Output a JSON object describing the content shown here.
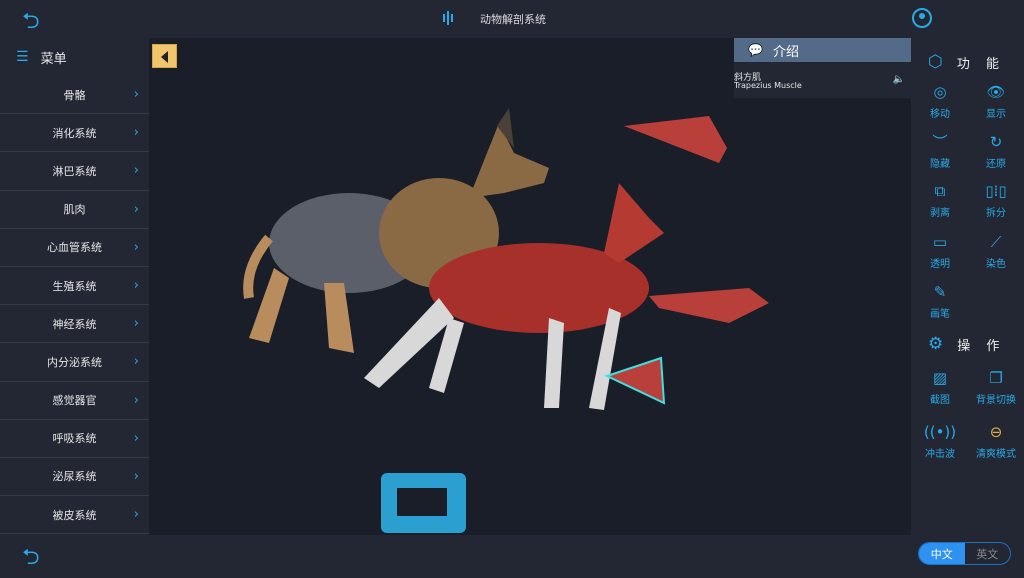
{
  "header": {
    "title": "动物解剖系统",
    "back_icon": "back-arrow-icon",
    "user_icon": "user-icon"
  },
  "sidebar": {
    "title": "菜单",
    "items": [
      {
        "label": "骨骼"
      },
      {
        "label": "消化系统"
      },
      {
        "label": "淋巴系统"
      },
      {
        "label": "肌肉"
      },
      {
        "label": "心血管系统"
      },
      {
        "label": "生殖系统"
      },
      {
        "label": "神经系统"
      },
      {
        "label": "内分泌系统"
      },
      {
        "label": "感觉器官"
      },
      {
        "label": "呼吸系统"
      },
      {
        "label": "泌尿系统"
      },
      {
        "label": "被皮系统"
      }
    ]
  },
  "intro": {
    "title": "介绍",
    "name_cn": "斜方肌",
    "name_en": "Trapezius Muscle"
  },
  "functions": {
    "title": "功 能",
    "tools": [
      {
        "label": "移动",
        "icon": "target-icon"
      },
      {
        "label": "显示",
        "icon": "eye-icon"
      },
      {
        "label": "隐藏",
        "icon": "eye-closed-icon"
      },
      {
        "label": "还原",
        "icon": "reset-icon"
      },
      {
        "label": "剥离",
        "icon": "detach-icon"
      },
      {
        "label": "拆分",
        "icon": "split-icon"
      },
      {
        "label": "透明",
        "icon": "transparent-icon"
      },
      {
        "label": "染色",
        "icon": "dropper-icon"
      },
      {
        "label": "画笔",
        "icon": "pen-icon"
      }
    ]
  },
  "operations": {
    "title": "操 作",
    "tools": [
      {
        "label": "截图",
        "icon": "image-icon"
      },
      {
        "label": "背景切换",
        "icon": "copy-icon"
      },
      {
        "label": "冲击波",
        "icon": "broadcast-icon"
      },
      {
        "label": "清爽模式",
        "icon": "minus-circle-icon"
      }
    ]
  },
  "language": {
    "options": [
      "中文",
      "英文"
    ],
    "selected": "中文"
  },
  "colors": {
    "accent": "#2aa9e6",
    "collapse": "#f1c56c",
    "intro_header": "#536a89"
  }
}
